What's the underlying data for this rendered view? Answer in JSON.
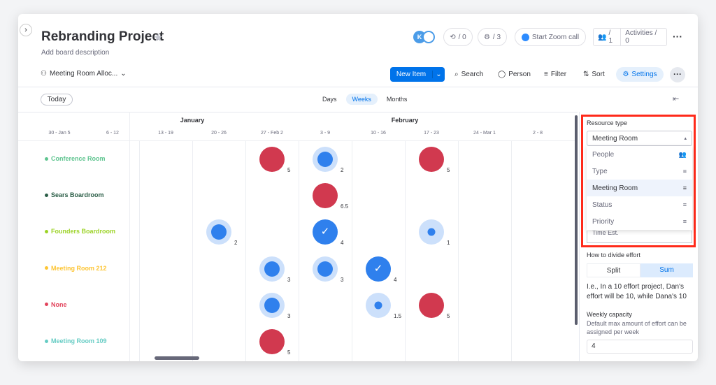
{
  "header": {
    "title": "Rebranding Project",
    "description": "Add board description",
    "avatar_initial": "K",
    "integrations_count": "/ 0",
    "automations_count": "/ 3",
    "zoom_label": "Start Zoom call",
    "members_count": "/ 1",
    "activities_label": "Activities / 0"
  },
  "toolbar": {
    "view_name": "Meeting Room Alloc...",
    "new_item": "New Item",
    "search": "Search",
    "person": "Person",
    "filter": "Filter",
    "sort": "Sort",
    "settings": "Settings"
  },
  "timeline": {
    "today": "Today",
    "scales": [
      "Days",
      "Weeks",
      "Months"
    ],
    "active_scale": "Weeks",
    "months": [
      {
        "label": "January"
      },
      {
        "label": "February"
      }
    ],
    "weeks": [
      "30 - Jan 5",
      "6 - 12",
      "13 - 19",
      "20 - 26",
      "27 - Feb 2",
      "3 - 9",
      "10 - 16",
      "17 - 23",
      "24 - Mar 1",
      "2 - 8"
    ],
    "rows": [
      {
        "label": "Conference Room",
        "color": "#5ec48f",
        "items": [
          {
            "week": 4,
            "kind": "red",
            "value": "5"
          },
          {
            "week": 5,
            "kind": "halo-large",
            "value": "2"
          },
          {
            "week": 7,
            "kind": "red",
            "value": "5"
          }
        ]
      },
      {
        "label": "Sears Boardroom",
        "color": "#2b5e47",
        "items": [
          {
            "week": 5,
            "kind": "red",
            "value": "6.5"
          }
        ]
      },
      {
        "label": "Founders Boardroom",
        "color": "#9cd326",
        "items": [
          {
            "week": 3,
            "kind": "halo-large",
            "value": "2"
          },
          {
            "week": 5,
            "kind": "check",
            "value": "4"
          },
          {
            "week": 7,
            "kind": "halo-small",
            "value": "1"
          }
        ]
      },
      {
        "label": "Meeting Room 212",
        "color": "#fdc534",
        "items": [
          {
            "week": 4,
            "kind": "halo-large",
            "value": "3"
          },
          {
            "week": 5,
            "kind": "halo-large",
            "value": "3"
          },
          {
            "week": 6,
            "kind": "check",
            "value": "4"
          }
        ]
      },
      {
        "label": "None",
        "color": "#e2445c",
        "items": [
          {
            "week": 4,
            "kind": "halo-large",
            "value": "3"
          },
          {
            "week": 6,
            "kind": "halo-small",
            "value": "1.5"
          },
          {
            "week": 7,
            "kind": "red",
            "value": "5"
          }
        ]
      },
      {
        "label": "Meeting Room 109",
        "color": "#66ccc4",
        "items": [
          {
            "week": 4,
            "kind": "red",
            "value": "5"
          }
        ]
      }
    ]
  },
  "settings_panel": {
    "resource_type_label": "Resource type",
    "resource_type_value": "Meeting Room",
    "options": [
      {
        "label": "People",
        "icon": "people-icon"
      },
      {
        "label": "Type",
        "icon": "lines-icon"
      },
      {
        "label": "Meeting Room",
        "icon": "lines-icon",
        "selected": true
      },
      {
        "label": "Status",
        "icon": "lines-icon"
      },
      {
        "label": "Priority",
        "icon": "lines-icon"
      }
    ],
    "hidden_option_partial": "Time Est.",
    "divide_label": "How to divide effort",
    "split": "Split",
    "sum": "Sum",
    "divide_selected": "Sum",
    "explain": "I.e., In a 10 effort project, Dan's effort will be 10, while Dana's 10",
    "capacity_label": "Weekly capacity",
    "capacity_help": "Default max amount of effort can be assigned per week",
    "capacity_value": "4"
  },
  "colors": {
    "accent": "#0073ea",
    "red": "#d1394f",
    "halo": "#cce0fb",
    "highlight": "#ff2a1a"
  }
}
